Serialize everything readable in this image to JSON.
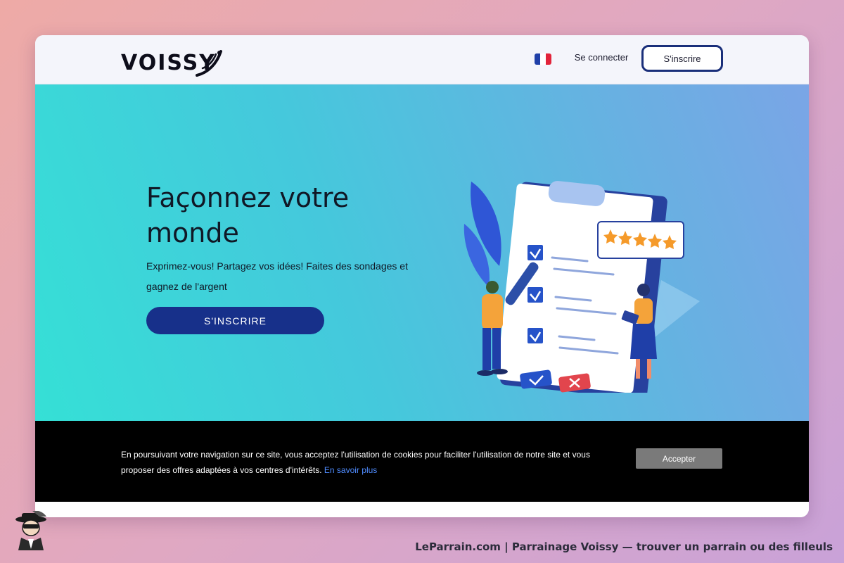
{
  "header": {
    "logo_text": "VOISSY",
    "language_flag": "french-flag-icon",
    "login_label": "Se connecter",
    "signup_label": "S'inscrire"
  },
  "hero": {
    "title": "Façonnez votre monde",
    "subtitle": "Exprimez-vous! Partagez vos idées! Faites des sondages et gagnez de l'argent",
    "cta_label": "S'INSCRIRE",
    "illustration": "survey-clipboard-illustration",
    "rating_stars": 5
  },
  "cookie_banner": {
    "text": "En poursuivant votre navigation sur ce site, vous acceptez l'utilisation de cookies pour faciliter l'utilisation de notre site et vous proposer des offres adaptées à vos centres d'intérêts.",
    "link_label": "En savoir plus",
    "accept_label": "Accepter"
  },
  "watermark": {
    "caption": "LeParrain.com | Parrainage Voissy — trouver un parrain ou des filleuls",
    "mascot": "mascot-icon"
  },
  "colors": {
    "accent": "#17308a",
    "hero_gradient_start": "#35e0d6",
    "hero_gradient_end": "#7aa5e6",
    "cookie_link": "#4f8cff"
  }
}
